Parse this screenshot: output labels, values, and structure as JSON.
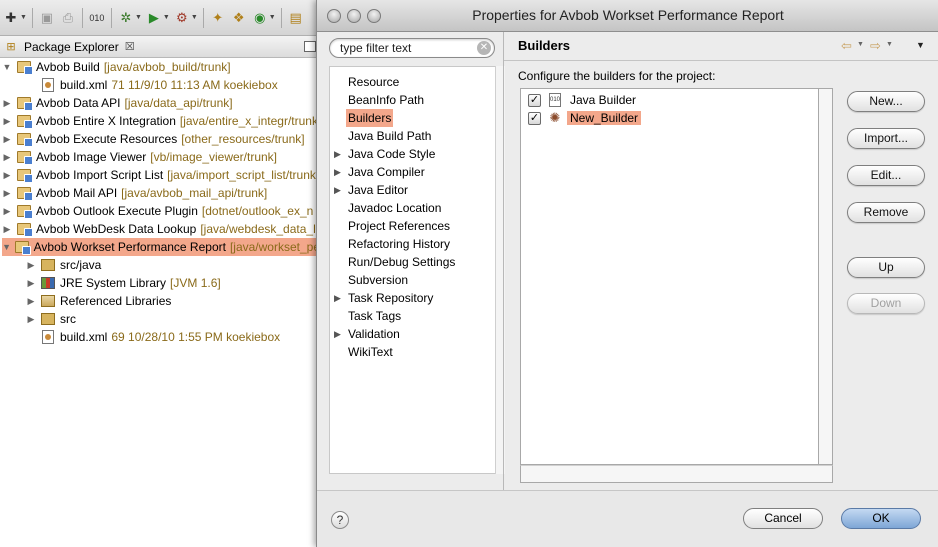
{
  "eclipse": {
    "package_explorer": {
      "title": "Package Explorer",
      "close_symbol": "☒",
      "tree": [
        {
          "label": "Avbob Build",
          "deco": "[java/avbob_build/trunk]",
          "level": 0,
          "expanded": true,
          "icon": "project-icon",
          "selected": false
        },
        {
          "label": "build.xml",
          "deco": "71  11/9/10 11:13 AM  koekiebox",
          "level": 1,
          "expanded": null,
          "icon": "xml-file-icon",
          "selected": false
        },
        {
          "label": "Avbob Data API",
          "deco": "[java/data_api/trunk]",
          "level": 0,
          "expanded": false,
          "icon": "project-icon",
          "selected": false
        },
        {
          "label": "Avbob Entire X Integration",
          "deco": "[java/entire_x_integr/trunk]",
          "level": 0,
          "expanded": false,
          "icon": "project-icon",
          "selected": false
        },
        {
          "label": "Avbob Execute Resources",
          "deco": "[other_resources/trunk]",
          "level": 0,
          "expanded": false,
          "icon": "project-icon",
          "selected": false
        },
        {
          "label": "Avbob Image Viewer",
          "deco": "[vb/image_viewer/trunk]",
          "level": 0,
          "expanded": false,
          "icon": "project-icon",
          "selected": false
        },
        {
          "label": "Avbob Import Script List",
          "deco": "[java/import_script_list/trunk]",
          "level": 0,
          "expanded": false,
          "icon": "project-icon",
          "selected": false
        },
        {
          "label": "Avbob Mail API",
          "deco": "[java/avbob_mail_api/trunk]",
          "level": 0,
          "expanded": false,
          "icon": "project-icon",
          "selected": false
        },
        {
          "label": "Avbob Outlook Execute Plugin",
          "deco": "[dotnet/outlook_ex_n",
          "level": 0,
          "expanded": false,
          "icon": "project-icon",
          "selected": false
        },
        {
          "label": "Avbob WebDesk Data Lookup",
          "deco": "[java/webdesk_data_lo",
          "level": 0,
          "expanded": false,
          "icon": "project-icon",
          "selected": false
        },
        {
          "label": "Avbob Workset Performance Report",
          "deco": "[java/workset_pe",
          "level": 0,
          "expanded": true,
          "icon": "project-icon",
          "selected": true
        },
        {
          "label": "src/java",
          "deco": "",
          "level": 1,
          "expanded": false,
          "icon": "package-folder-icon",
          "selected": false
        },
        {
          "label": "JRE System Library",
          "deco": "[JVM 1.6]",
          "level": 1,
          "expanded": false,
          "icon": "jre-library-icon",
          "selected": false
        },
        {
          "label": "Referenced Libraries",
          "deco": "",
          "level": 1,
          "expanded": false,
          "icon": "library-icon",
          "selected": false
        },
        {
          "label": "src",
          "deco": "",
          "level": 1,
          "expanded": false,
          "icon": "package-folder-icon",
          "selected": false
        },
        {
          "label": "build.xml",
          "deco": "69  10/28/10 1:55 PM  koekiebox",
          "level": 1,
          "expanded": null,
          "icon": "xml-file-icon",
          "selected": false
        }
      ]
    }
  },
  "dialog": {
    "title": "Properties for Avbob Workset Performance Report",
    "filter": {
      "value": "type filter text",
      "placeholder": "type filter text"
    },
    "pages": [
      {
        "label": "Resource",
        "expandable": false,
        "selected": false
      },
      {
        "label": "BeanInfo Path",
        "expandable": false,
        "selected": false
      },
      {
        "label": "Builders",
        "expandable": false,
        "selected": true
      },
      {
        "label": "Java Build Path",
        "expandable": false,
        "selected": false
      },
      {
        "label": "Java Code Style",
        "expandable": true,
        "selected": false
      },
      {
        "label": "Java Compiler",
        "expandable": true,
        "selected": false
      },
      {
        "label": "Java Editor",
        "expandable": true,
        "selected": false
      },
      {
        "label": "Javadoc Location",
        "expandable": false,
        "selected": false
      },
      {
        "label": "Project References",
        "expandable": false,
        "selected": false
      },
      {
        "label": "Refactoring History",
        "expandable": false,
        "selected": false
      },
      {
        "label": "Run/Debug Settings",
        "expandable": false,
        "selected": false
      },
      {
        "label": "Subversion",
        "expandable": false,
        "selected": false
      },
      {
        "label": "Task Repository",
        "expandable": true,
        "selected": false
      },
      {
        "label": "Task Tags",
        "expandable": false,
        "selected": false
      },
      {
        "label": "Validation",
        "expandable": true,
        "selected": false
      },
      {
        "label": "WikiText",
        "expandable": false,
        "selected": false
      }
    ],
    "page_title": "Builders",
    "description": "Configure the builders for the project:",
    "builders": [
      {
        "label": "Java Builder",
        "checked": true,
        "selected": false,
        "icon": "java-builder-icon"
      },
      {
        "label": "New_Builder",
        "checked": true,
        "selected": true,
        "icon": "ant-builder-icon"
      }
    ],
    "buttons": {
      "new": "New...",
      "import": "Import...",
      "edit": "Edit...",
      "remove": "Remove",
      "up": "Up",
      "down": "Down"
    },
    "footer": {
      "help": "?",
      "cancel": "Cancel",
      "ok": "OK"
    },
    "colors": {
      "selection": "#f3a78b",
      "decoration_text": "#8a6a1a"
    }
  }
}
